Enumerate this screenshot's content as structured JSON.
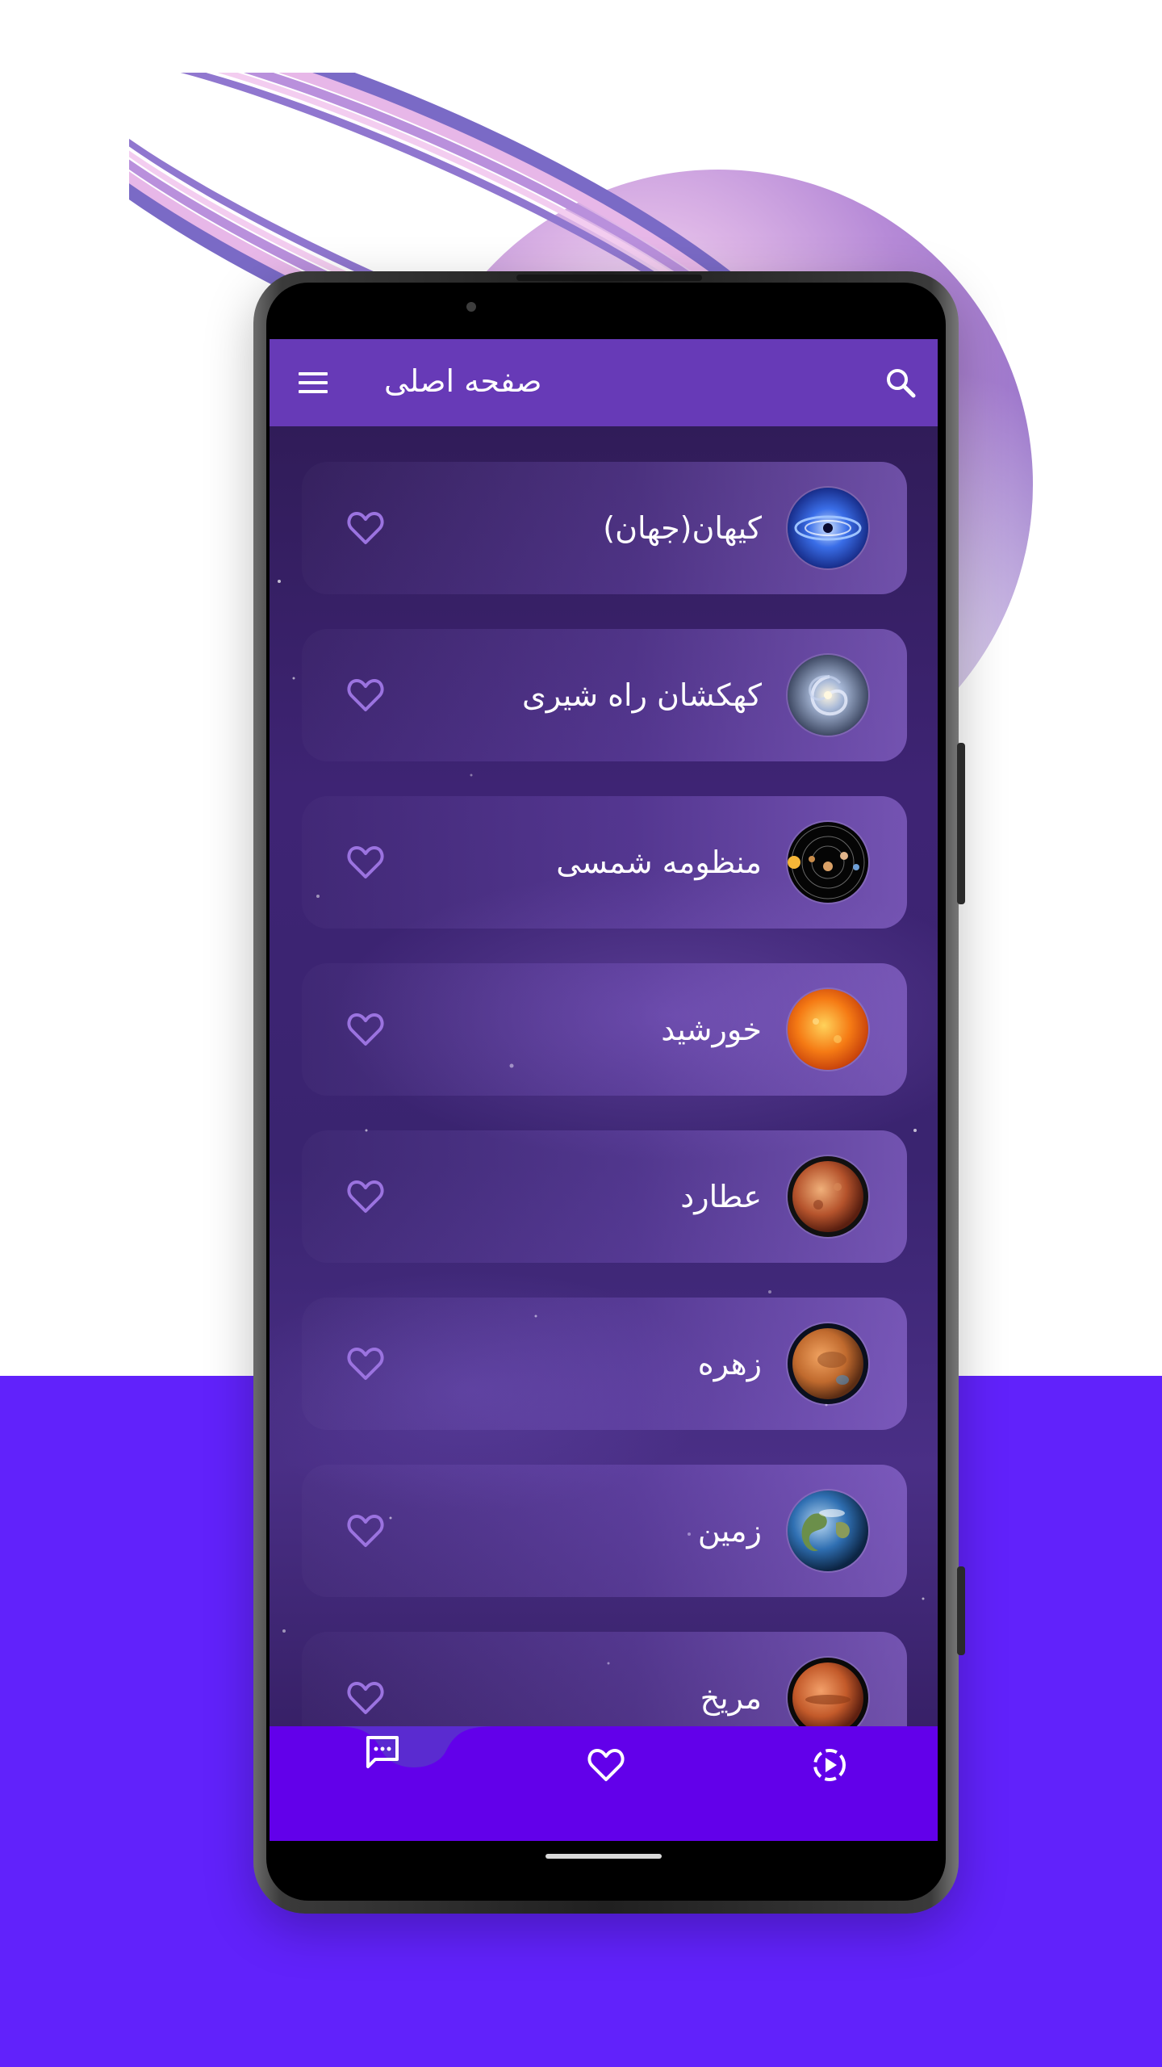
{
  "app_bar": {
    "title": "صفحه اصلی",
    "menu_icon": "hamburger-menu-icon",
    "search_icon": "search-icon",
    "color": "#673ab7"
  },
  "items": [
    {
      "label": "کیهان(جهان)",
      "thumbnail": "universe-icon"
    },
    {
      "label": "کهکشان راه شیری",
      "thumbnail": "milky-way-icon"
    },
    {
      "label": "منظومه شمسی",
      "thumbnail": "solar-system-icon"
    },
    {
      "label": "خورشید",
      "thumbnail": "sun-icon"
    },
    {
      "label": "عطارد",
      "thumbnail": "mercury-icon"
    },
    {
      "label": "زهره",
      "thumbnail": "venus-icon"
    },
    {
      "label": "زمین",
      "thumbnail": "earth-icon"
    },
    {
      "label": "مریخ",
      "thumbnail": "mars-icon"
    }
  ],
  "favorite_icon": "heart-outline-icon",
  "bottom_nav": {
    "color": "#6200ea",
    "items": [
      {
        "icon": "chat-icon",
        "selected": true
      },
      {
        "icon": "heart-icon",
        "selected": false
      },
      {
        "icon": "play-circle-icon",
        "selected": false
      }
    ]
  },
  "colors": {
    "backdrop": "#6122fb",
    "heart": "#9b73e0",
    "text": "#ffffff"
  }
}
